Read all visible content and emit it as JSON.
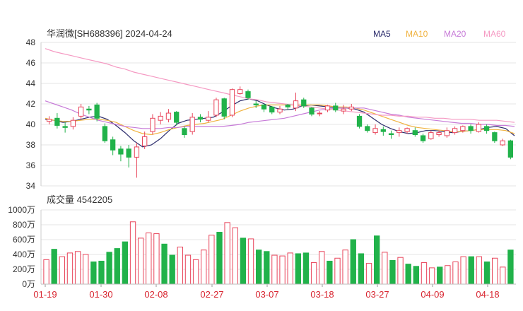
{
  "header": {
    "title": "华润微[SH688396] 2024-04-24"
  },
  "legend": [
    {
      "label": "MA5",
      "color": "#2b2b6b"
    },
    {
      "label": "MA10",
      "color": "#f0b341"
    },
    {
      "label": "MA20",
      "color": "#c77bd8"
    },
    {
      "label": "MA60",
      "color": "#f59ac3"
    }
  ],
  "volume_header": {
    "label": "成交量 4542205"
  },
  "colors": {
    "up": "#e8445a",
    "down": "#21b24a",
    "grid": "#e6e6e6",
    "axis_text": "#333333",
    "date_text": "#d8242f"
  },
  "chart_data": [
    {
      "type": "candlestick",
      "title": "华润微[SH688396] 2024-04-24",
      "ylim": [
        34,
        48
      ],
      "yticks": [
        "48",
        "46",
        "44",
        "42",
        "40",
        "38",
        "36",
        "34"
      ],
      "series": [
        {
          "name": "MA5",
          "values": [
            40.5,
            40.4,
            40.2,
            40.3,
            40.5,
            40.7,
            40.8,
            40.5,
            39.9,
            39.2,
            38.4,
            37.8,
            38.0,
            38.6,
            39.4,
            40.1,
            40.4,
            40.5,
            40.6,
            40.7,
            41.2,
            41.8,
            42.3,
            42.5,
            42.3,
            41.9,
            41.6,
            41.4,
            41.5,
            41.8,
            41.9,
            41.8,
            41.7,
            41.6,
            41.6,
            41.5,
            41.2,
            40.6,
            40.0,
            39.6,
            39.3,
            39.1,
            39.2,
            39.4,
            39.4,
            39.3,
            39.2,
            39.3,
            39.4,
            39.5,
            39.7,
            39.8,
            39.6,
            38.9
          ]
        },
        {
          "name": "MA10",
          "values": [
            40.6,
            40.4,
            40.3,
            40.3,
            40.4,
            40.5,
            40.5,
            40.4,
            40.2,
            39.8,
            39.4,
            39.1,
            39.0,
            39.2,
            39.5,
            39.7,
            39.9,
            40.0,
            40.1,
            40.3,
            40.5,
            40.9,
            41.3,
            41.6,
            41.8,
            41.9,
            41.9,
            41.9,
            41.9,
            41.9,
            41.9,
            41.9,
            41.8,
            41.7,
            41.7,
            41.6,
            41.4,
            41.1,
            40.8,
            40.5,
            40.2,
            39.9,
            39.7,
            39.6,
            39.5,
            39.4,
            39.3,
            39.3,
            39.4,
            39.5,
            39.5,
            39.5,
            39.4,
            39.1
          ]
        },
        {
          "name": "MA20",
          "values": [
            42.3,
            42.0,
            41.7,
            41.4,
            41.0,
            40.7,
            40.4,
            40.2,
            40.0,
            39.8,
            39.7,
            39.6,
            39.6,
            39.6,
            39.7,
            39.7,
            39.8,
            39.8,
            39.8,
            39.8,
            39.8,
            39.9,
            40.0,
            40.2,
            40.3,
            40.4,
            40.5,
            40.6,
            40.8,
            41.0,
            41.2,
            41.4,
            41.5,
            41.6,
            41.6,
            41.6,
            41.6,
            41.4,
            41.2,
            41.0,
            40.9,
            40.7,
            40.6,
            40.5,
            40.4,
            40.3,
            40.2,
            40.1,
            40.1,
            40.0,
            40.0,
            39.9,
            39.9,
            39.8
          ]
        },
        {
          "name": "MA60",
          "values": [
            47.4,
            47.1,
            46.9,
            46.7,
            46.5,
            46.3,
            46.1,
            45.9,
            45.6,
            45.4,
            45.1,
            44.9,
            44.7,
            44.5,
            44.3,
            44.1,
            43.9,
            43.7,
            43.5,
            43.3,
            43.1,
            42.9,
            42.7,
            42.5,
            42.4,
            42.2,
            42.1,
            42.0,
            41.9,
            41.8,
            41.7,
            41.6,
            41.5,
            41.4,
            41.3,
            41.2,
            41.1,
            41.0,
            40.9,
            40.9,
            40.8,
            40.8,
            40.7,
            40.7,
            40.6,
            40.6,
            40.5,
            40.5,
            40.5,
            40.4,
            40.4,
            40.4,
            40.3,
            40.2
          ]
        }
      ],
      "candles": [
        [
          40.3,
          40.5,
          40.0,
          40.8
        ],
        [
          40.6,
          39.9,
          39.6,
          41.1
        ],
        [
          39.8,
          39.7,
          39.2,
          40.2
        ],
        [
          39.8,
          40.4,
          39.5,
          40.7
        ],
        [
          40.8,
          41.7,
          40.5,
          42.0
        ],
        [
          41.5,
          41.4,
          41.0,
          41.8
        ],
        [
          41.9,
          40.6,
          40.3,
          42.1
        ],
        [
          39.8,
          38.4,
          38.2,
          40.1
        ],
        [
          38.5,
          37.5,
          37.0,
          38.8
        ],
        [
          37.6,
          37.1,
          36.4,
          37.9
        ],
        [
          37.6,
          36.8,
          35.8,
          38.0
        ],
        [
          36.8,
          37.8,
          34.8,
          38.2
        ],
        [
          37.9,
          38.8,
          37.6,
          39.3
        ],
        [
          39.3,
          40.6,
          39.0,
          41.0
        ],
        [
          40.4,
          40.8,
          40.0,
          41.2
        ],
        [
          40.5,
          41.1,
          40.2,
          41.5
        ],
        [
          41.2,
          40.2,
          39.9,
          41.3
        ],
        [
          39.6,
          39.0,
          38.7,
          39.8
        ],
        [
          39.3,
          40.7,
          39.0,
          41.1
        ],
        [
          40.7,
          40.5,
          40.2,
          41.0
        ],
        [
          40.4,
          40.7,
          40.2,
          41.3
        ],
        [
          40.9,
          42.4,
          40.7,
          42.6
        ],
        [
          42.5,
          40.8,
          40.5,
          42.6
        ],
        [
          40.9,
          43.4,
          40.7,
          43.5
        ],
        [
          43.0,
          43.4,
          42.9,
          43.7
        ],
        [
          43.2,
          42.6,
          42.4,
          43.4
        ],
        [
          42.0,
          41.9,
          41.6,
          42.3
        ],
        [
          41.9,
          41.5,
          41.2,
          42.0
        ],
        [
          41.7,
          41.2,
          41.0,
          41.8
        ],
        [
          41.2,
          41.5,
          41.0,
          41.8
        ],
        [
          41.9,
          41.7,
          41.4,
          42.0
        ],
        [
          41.6,
          42.3,
          41.3,
          43.1
        ],
        [
          42.4,
          41.8,
          41.6,
          42.6
        ],
        [
          41.6,
          41.0,
          40.8,
          41.7
        ],
        [
          41.1,
          41.1,
          40.8,
          41.3
        ],
        [
          41.4,
          41.8,
          41.2,
          41.9
        ],
        [
          41.8,
          41.4,
          41.2,
          42.1
        ],
        [
          41.3,
          41.5,
          41.0,
          41.9
        ],
        [
          41.5,
          41.7,
          41.3,
          42.0
        ],
        [
          40.8,
          39.8,
          39.6,
          41.0
        ],
        [
          39.8,
          39.4,
          39.2,
          40.0
        ],
        [
          39.2,
          39.6,
          39.0,
          40.0
        ],
        [
          39.5,
          39.3,
          38.9,
          39.8
        ],
        [
          39.1,
          39.0,
          38.6,
          39.4
        ],
        [
          39.2,
          39.4,
          38.8,
          39.7
        ],
        [
          39.3,
          39.6,
          39.1,
          39.7
        ],
        [
          39.4,
          39.0,
          38.8,
          39.7
        ],
        [
          38.9,
          38.4,
          38.2,
          39.1
        ],
        [
          38.6,
          39.2,
          38.5,
          39.4
        ],
        [
          39.0,
          39.2,
          38.8,
          39.4
        ],
        [
          38.9,
          39.4,
          38.7,
          39.7
        ],
        [
          39.2,
          39.6,
          39.0,
          39.8
        ],
        [
          39.4,
          39.8,
          39.2,
          39.9
        ],
        [
          39.8,
          39.4,
          39.1,
          40.0
        ],
        [
          39.3,
          40.0,
          39.2,
          40.2
        ],
        [
          39.8,
          39.4,
          39.1,
          40.0
        ],
        [
          39.2,
          38.4,
          38.2,
          39.3
        ],
        [
          38.0,
          38.4,
          37.9,
          38.6
        ],
        [
          38.4,
          36.8,
          36.6,
          38.5
        ]
      ]
    },
    {
      "type": "bar",
      "title": "成交量 4542205",
      "ylim": [
        0,
        1000
      ],
      "yticks": [
        "1000万",
        "800万",
        "600万",
        "400万",
        "200万",
        "0万"
      ],
      "x": [
        "01-19",
        "01-30",
        "02-08",
        "02-27",
        "03-07",
        "03-18",
        "03-27",
        "04-09",
        "04-18"
      ],
      "values": [
        330,
        470,
        370,
        420,
        440,
        400,
        300,
        310,
        430,
        480,
        570,
        840,
        620,
        690,
        680,
        540,
        390,
        500,
        390,
        330,
        460,
        660,
        700,
        830,
        760,
        620,
        610,
        460,
        440,
        390,
        380,
        420,
        410,
        420,
        290,
        440,
        310,
        350,
        460,
        600,
        410,
        280,
        650,
        430,
        320,
        360,
        270,
        240,
        290,
        220,
        230,
        250,
        300,
        370,
        370,
        370,
        300,
        350,
        230,
        460
      ],
      "up": [
        true,
        false,
        true,
        true,
        true,
        true,
        false,
        false,
        false,
        false,
        false,
        true,
        true,
        true,
        true,
        false,
        false,
        true,
        true,
        true,
        true,
        true,
        false,
        true,
        true,
        false,
        true,
        false,
        false,
        true,
        true,
        true,
        false,
        false,
        true,
        true,
        false,
        true,
        true,
        false,
        false,
        true,
        false,
        true,
        false,
        true,
        false,
        false,
        true,
        true,
        false,
        true,
        true,
        true,
        false,
        true,
        false,
        true,
        true,
        false
      ]
    }
  ]
}
